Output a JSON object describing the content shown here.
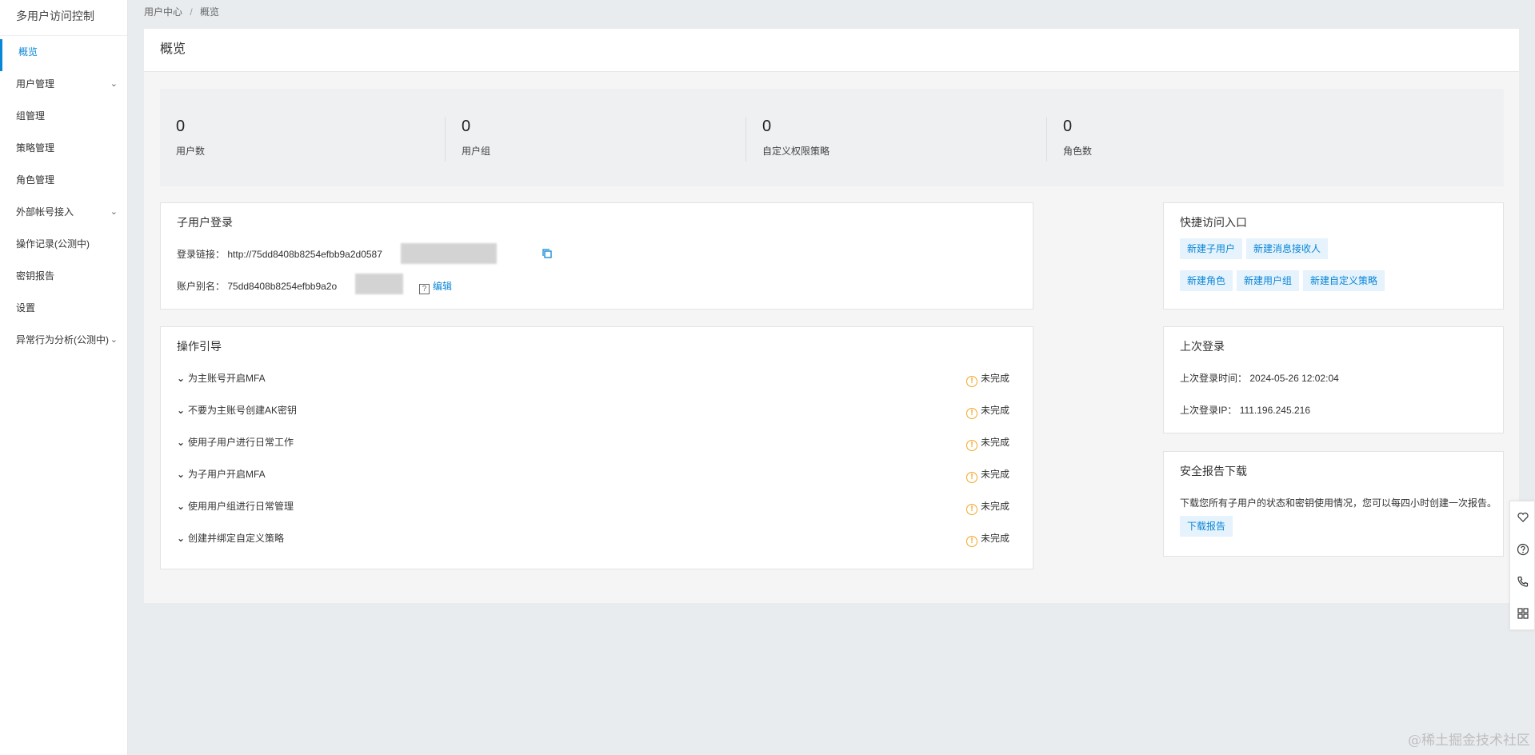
{
  "sidebar": {
    "title": "多用户访问控制",
    "items": [
      {
        "label": "概览"
      },
      {
        "label": "用户管理"
      },
      {
        "label": "组管理"
      },
      {
        "label": "策略管理"
      },
      {
        "label": "角色管理"
      },
      {
        "label": "外部帐号接入"
      },
      {
        "label": "操作记录(公测中)"
      },
      {
        "label": "密钥报告"
      },
      {
        "label": "设置"
      },
      {
        "label": "异常行为分析(公测中)"
      }
    ]
  },
  "breadcrumb": {
    "parent": "用户中心",
    "separator": "/",
    "current": "概览"
  },
  "page_title": "概览",
  "stats": [
    {
      "value": "0",
      "label": "用户数"
    },
    {
      "value": "0",
      "label": "用户组"
    },
    {
      "value": "0",
      "label": "自定义权限策略"
    },
    {
      "value": "0",
      "label": "角色数"
    }
  ],
  "sub_user_login": {
    "title": "子用户登录",
    "link_label": "登录链接：",
    "link_value": "http://75dd8408b8254efbb9a2d0587",
    "alias_label": "账户别名：",
    "alias_value": "75dd8408b8254efbb9a2o",
    "help_mark": "?",
    "edit_label": "编辑"
  },
  "guide": {
    "title": "操作引导",
    "items": [
      {
        "label": "为主账号开启MFA",
        "status": "未完成"
      },
      {
        "label": "不要为主账号创建AK密钥",
        "status": "未完成"
      },
      {
        "label": "使用子用户进行日常工作",
        "status": "未完成"
      },
      {
        "label": "为子用户开启MFA",
        "status": "未完成"
      },
      {
        "label": "使用用户组进行日常管理",
        "status": "未完成"
      },
      {
        "label": "创建并绑定自定义策略",
        "status": "未完成"
      }
    ]
  },
  "quick_access": {
    "title": "快捷访问入口",
    "buttons": [
      "新建子用户",
      "新建消息接收人",
      "新建角色",
      "新建用户组",
      "新建自定义策略"
    ]
  },
  "last_login": {
    "title": "上次登录",
    "time_label": "上次登录时间：",
    "time_value": "2024-05-26 12:02:04",
    "ip_label": "上次登录IP：",
    "ip_value": "111.196.245.216"
  },
  "security_report": {
    "title": "安全报告下载",
    "description": "下载您所有子用户的状态和密钥使用情况，您可以每四小时创建一次报告。",
    "button": "下载报告"
  },
  "watermark": "@稀土掘金技术社区",
  "colors": {
    "accent": "#0a86d6",
    "warning": "#f5a623",
    "tag_bg": "#e6f3fc"
  }
}
